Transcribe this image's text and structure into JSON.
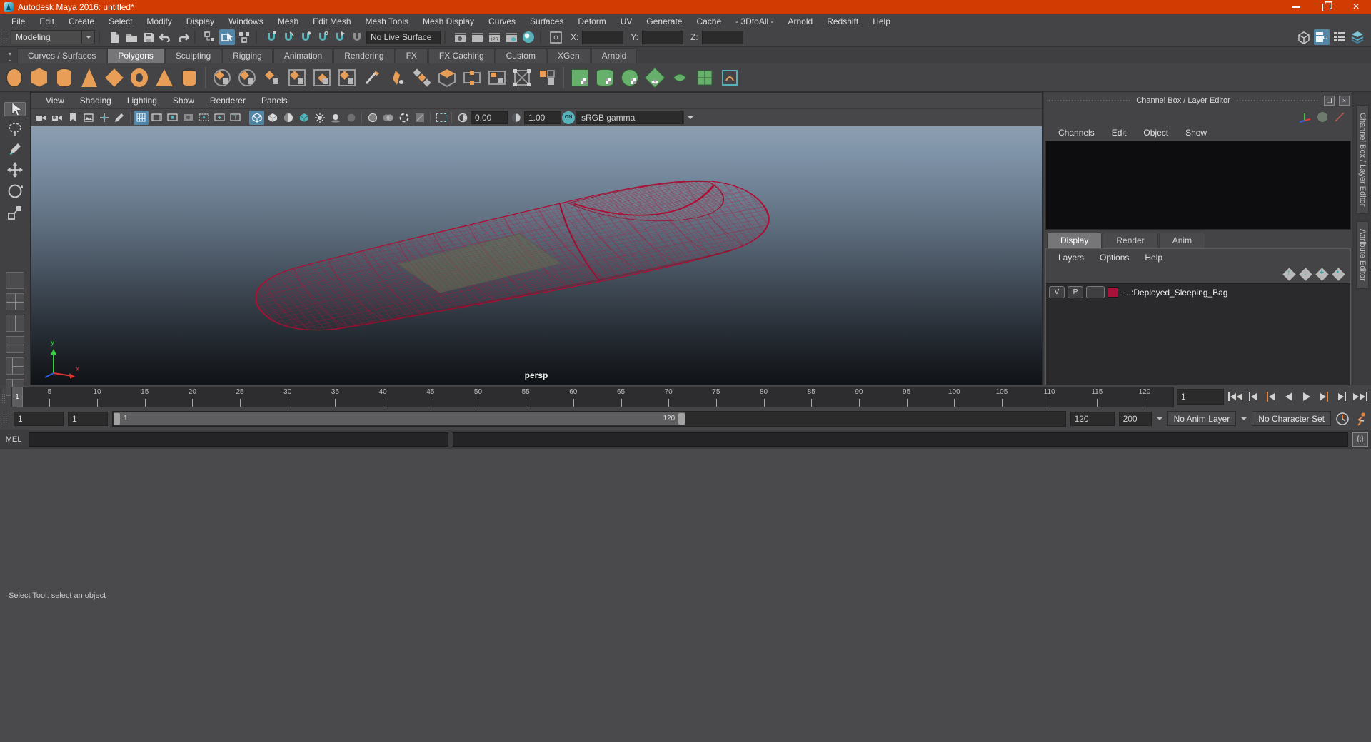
{
  "window": {
    "title": "Autodesk Maya 2016: untitled*"
  },
  "menu_bar": {
    "items": [
      "File",
      "Edit",
      "Create",
      "Select",
      "Modify",
      "Display",
      "Windows",
      "Mesh",
      "Edit Mesh",
      "Mesh Tools",
      "Mesh Display",
      "Curves",
      "Surfaces",
      "Deform",
      "UV",
      "Generate",
      "Cache",
      "- 3DtoAll -",
      "Arnold",
      "Redshift",
      "Help"
    ]
  },
  "toolbar": {
    "workspace": "Modeling",
    "live_surface": "No Live Surface",
    "axis_fields": [
      {
        "label": "X:",
        "value": ""
      },
      {
        "label": "Y:",
        "value": ""
      },
      {
        "label": "Z:",
        "value": ""
      }
    ]
  },
  "shelf": {
    "active_tab": "Polygons",
    "tabs": [
      "Curves / Surfaces",
      "Polygons",
      "Sculpting",
      "Rigging",
      "Animation",
      "Rendering",
      "FX",
      "FX Caching",
      "Custom",
      "XGen",
      "Arnold"
    ]
  },
  "viewport": {
    "menus": [
      "View",
      "Shading",
      "Lighting",
      "Show",
      "Renderer",
      "Panels"
    ],
    "exposure": "0.00",
    "gamma": "1.00",
    "toggle_label": "ON",
    "colorspace": "sRGB gamma",
    "camera_label": "persp",
    "axis_labels": {
      "x": "x",
      "y": "y"
    }
  },
  "channel_box": {
    "title": "Channel Box / Layer Editor",
    "menus": [
      "Channels",
      "Edit",
      "Object",
      "Show"
    ],
    "layer_editor": {
      "tabs": [
        "Display",
        "Render",
        "Anim"
      ],
      "active_tab": "Display",
      "menus": [
        "Layers",
        "Options",
        "Help"
      ],
      "layer": {
        "visibility": "V",
        "playback": "P",
        "name": "...:Deployed_Sleeping_Bag",
        "color": "#a8123a"
      }
    },
    "side_tabs": [
      "Channel Box / Layer Editor",
      "Attribute Editor"
    ]
  },
  "timeline": {
    "playhead_frame": "1",
    "ticks": [
      5,
      10,
      15,
      20,
      25,
      30,
      35,
      40,
      45,
      50,
      55,
      60,
      65,
      70,
      75,
      80,
      85,
      90,
      95,
      100,
      105,
      110,
      115,
      120
    ],
    "ruler_max": 122,
    "current_frame_field": "1"
  },
  "range_bar": {
    "anim_start": "1",
    "playback_start": "1",
    "range_start_label": "1",
    "range_end_label": "120",
    "playback_end": "120",
    "anim_end": "200",
    "anim_layer": "No Anim Layer",
    "character_set": "No Character Set"
  },
  "command_line": {
    "label": "MEL"
  },
  "help_line": {
    "text": "Select Tool: select an object"
  },
  "colors": {
    "titlebar": "#d23b02",
    "accent_blue": "#5285a6",
    "accent_teal": "#57b3ba",
    "wireframe": "#c01038",
    "layer_swatch": "#a8123a"
  }
}
